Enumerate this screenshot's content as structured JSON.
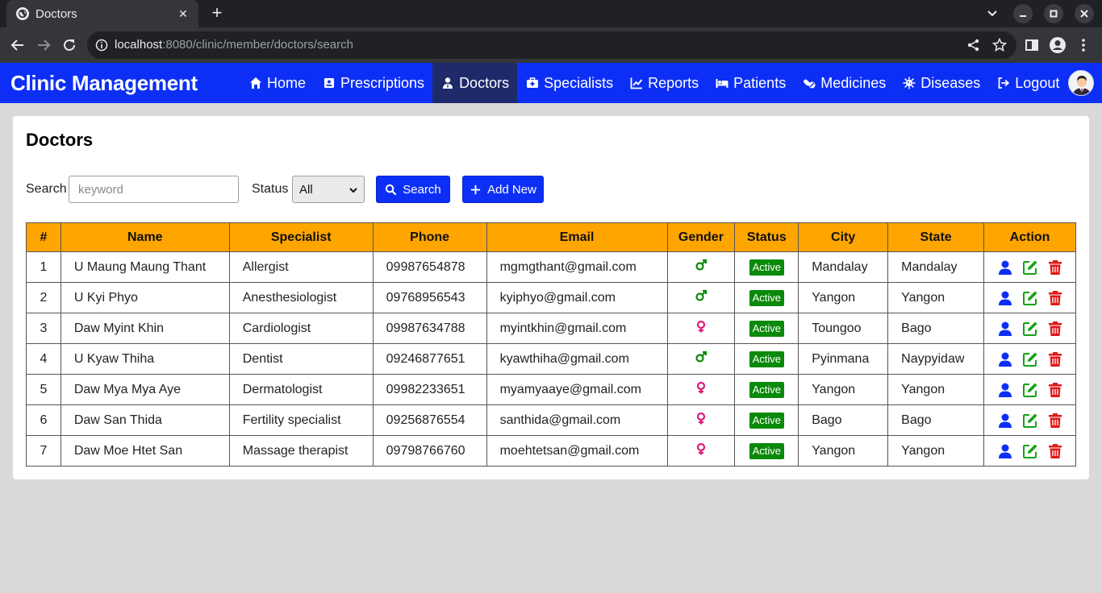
{
  "browser": {
    "tab_title": "Doctors",
    "url_host": "localhost",
    "url_path": ":8080/clinic/member/doctors/search"
  },
  "navbar": {
    "brand": "Clinic Management",
    "items": [
      {
        "label": "Home",
        "icon": "home-icon",
        "active": false
      },
      {
        "label": "Prescriptions",
        "icon": "prescription-icon",
        "active": false
      },
      {
        "label": "Doctors",
        "icon": "doctor-icon",
        "active": true
      },
      {
        "label": "Specialists",
        "icon": "medkit-icon",
        "active": false
      },
      {
        "label": "Reports",
        "icon": "chart-icon",
        "active": false
      },
      {
        "label": "Patients",
        "icon": "bed-icon",
        "active": false
      },
      {
        "label": "Medicines",
        "icon": "pills-icon",
        "active": false
      },
      {
        "label": "Diseases",
        "icon": "virus-icon",
        "active": false
      },
      {
        "label": "Logout",
        "icon": "logout-icon",
        "active": false
      }
    ]
  },
  "page": {
    "title": "Doctors",
    "search_label": "Search",
    "search_placeholder": "keyword",
    "status_label": "Status",
    "status_selected": "All",
    "search_button": "Search",
    "add_button": "Add New"
  },
  "table": {
    "headers": [
      "#",
      "Name",
      "Specialist",
      "Phone",
      "Email",
      "Gender",
      "Status",
      "City",
      "State",
      "Action"
    ],
    "rows": [
      {
        "no": "1",
        "name": "U Maung Maung Thant",
        "specialist": "Allergist",
        "phone": "09987654878",
        "email": "mgmgthant@gmail.com",
        "gender": "male",
        "status": "Active",
        "city": "Mandalay",
        "state": "Mandalay"
      },
      {
        "no": "2",
        "name": "U Kyi Phyo",
        "specialist": "Anesthesiologist",
        "phone": "09768956543",
        "email": "kyiphyo@gmail.com",
        "gender": "male",
        "status": "Active",
        "city": "Yangon",
        "state": "Yangon"
      },
      {
        "no": "3",
        "name": "Daw Myint Khin",
        "specialist": "Cardiologist",
        "phone": "09987634788",
        "email": "myintkhin@gmail.com",
        "gender": "female",
        "status": "Active",
        "city": "Toungoo",
        "state": "Bago"
      },
      {
        "no": "4",
        "name": "U Kyaw Thiha",
        "specialist": "Dentist",
        "phone": "09246877651",
        "email": "kyawthiha@gmail.com",
        "gender": "male",
        "status": "Active",
        "city": "Pyinmana",
        "state": "Naypyidaw"
      },
      {
        "no": "5",
        "name": "Daw Mya Mya Aye",
        "specialist": "Dermatologist",
        "phone": "09982233651",
        "email": "myamyaaye@gmail.com",
        "gender": "female",
        "status": "Active",
        "city": "Yangon",
        "state": "Yangon"
      },
      {
        "no": "6",
        "name": "Daw San Thida",
        "specialist": "Fertility specialist",
        "phone": "09256876554",
        "email": "santhida@gmail.com",
        "gender": "female",
        "status": "Active",
        "city": "Bago",
        "state": "Bago"
      },
      {
        "no": "7",
        "name": "Daw Moe Htet San",
        "specialist": "Massage therapist",
        "phone": "09798766760",
        "email": "moehtetsan@gmail.com",
        "gender": "female",
        "status": "Active",
        "city": "Yangon",
        "state": "Yangon"
      }
    ]
  },
  "colors": {
    "brand_blue": "#0d2ff5",
    "active_nav": "#1f2a6b",
    "table_header": "#ffa500",
    "status_green": "#0a8a0a",
    "male": "#0a8a0a",
    "female": "#e0197c",
    "view_icon": "#0d2ff5",
    "edit_icon": "#13a313",
    "delete_icon": "#e01818"
  }
}
